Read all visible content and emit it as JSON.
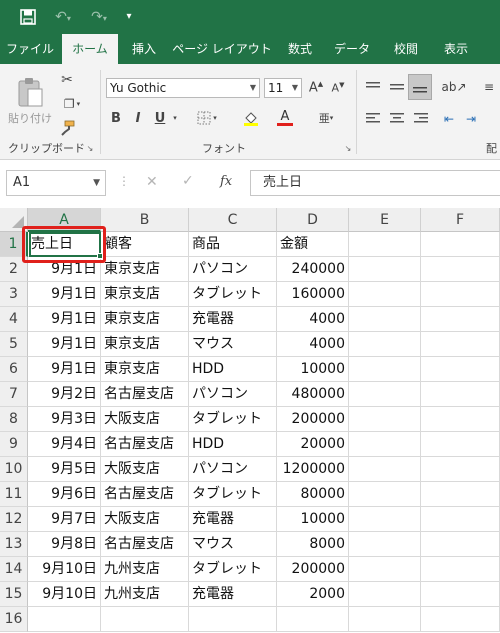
{
  "colors": {
    "brand": "#217346",
    "highlight_box": "#e0201b"
  },
  "quick_access": {
    "save_icon": "save-icon",
    "undo_icon": "undo-icon",
    "redo_icon": "redo-icon",
    "customize_icon": "customize-qat-icon"
  },
  "tabs": [
    "ファイル",
    "ホーム",
    "挿入",
    "ページ レイアウト",
    "数式",
    "データ",
    "校閲",
    "表示"
  ],
  "active_tab": "ホーム",
  "ribbon": {
    "clipboard": {
      "paste_label": "貼り付け",
      "group_label": "クリップボード"
    },
    "font": {
      "font_name": "Yu Gothic",
      "font_size": "11",
      "bold": "B",
      "italic": "I",
      "underline": "U",
      "group_label": "フォント"
    },
    "alignment": {
      "group_label_partial": "配"
    }
  },
  "formula_bar": {
    "name_box": "A1",
    "fx_label": "fx",
    "content": "売上日"
  },
  "grid": {
    "columns": [
      "A",
      "B",
      "C",
      "D",
      "E",
      "F"
    ],
    "rows": [
      "1",
      "2",
      "3",
      "4",
      "5",
      "6",
      "7",
      "8",
      "9",
      "10",
      "11",
      "12",
      "13",
      "14",
      "15",
      "16"
    ],
    "selected_cell": "A1",
    "cells": [
      [
        "売上日",
        "顧客",
        "商品",
        "金額"
      ],
      [
        "9月1日",
        "東京支店",
        "パソコン",
        "240000"
      ],
      [
        "9月1日",
        "東京支店",
        "タブレット",
        "160000"
      ],
      [
        "9月1日",
        "東京支店",
        "充電器",
        "4000"
      ],
      [
        "9月1日",
        "東京支店",
        "マウス",
        "4000"
      ],
      [
        "9月1日",
        "東京支店",
        "HDD",
        "10000"
      ],
      [
        "9月2日",
        "名古屋支店",
        "パソコン",
        "480000"
      ],
      [
        "9月3日",
        "大阪支店",
        "タブレット",
        "200000"
      ],
      [
        "9月4日",
        "名古屋支店",
        "HDD",
        "20000"
      ],
      [
        "9月5日",
        "大阪支店",
        "パソコン",
        "1200000"
      ],
      [
        "9月6日",
        "名古屋支店",
        "タブレット",
        "80000"
      ],
      [
        "9月7日",
        "大阪支店",
        "充電器",
        "10000"
      ],
      [
        "9月8日",
        "名古屋支店",
        "マウス",
        "8000"
      ],
      [
        "9月10日",
        "九州支店",
        "タブレット",
        "200000"
      ],
      [
        "9月10日",
        "九州支店",
        "充電器",
        "2000"
      ],
      [
        "",
        "",
        "",
        ""
      ]
    ]
  }
}
